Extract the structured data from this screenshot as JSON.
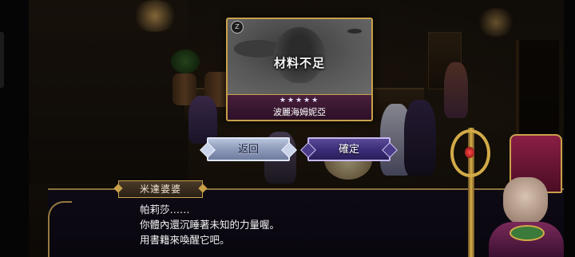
{
  "item": {
    "status": "材料不足",
    "rarity": "★★★★★",
    "name": "波麗海姆妮亞",
    "badge_icon": "rank-z-icon"
  },
  "buttons": {
    "back": "返回",
    "confirm": "確定"
  },
  "dialog": {
    "speaker": "米達婆婆",
    "lines": [
      "帕莉莎……",
      "你體內還沉睡著未知的力量喔。",
      "用書籍來喚醒它吧。"
    ]
  },
  "colors": {
    "frame_gold": "#c9a04a",
    "confirm_purple": "#3c2e78",
    "back_silver": "#8d9ab8",
    "item_footer": "#4a1f3c"
  }
}
